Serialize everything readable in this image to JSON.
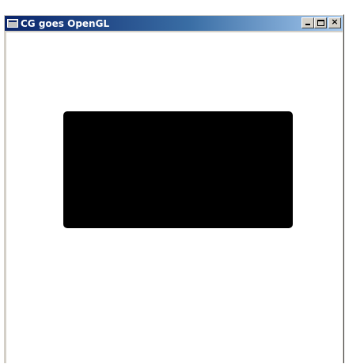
{
  "window": {
    "title": "CG goes OpenGL",
    "icon": "app-window-icon",
    "caption_buttons": {
      "minimize": "minimize-icon",
      "maximize": "maximize-icon",
      "close": "close-icon",
      "close_glyph": "×"
    }
  },
  "canvas": {
    "background_color": "#ffffff",
    "shape_color": "#000000"
  }
}
